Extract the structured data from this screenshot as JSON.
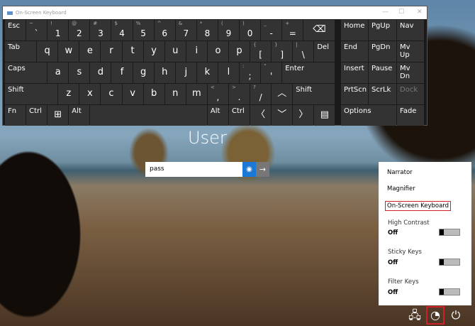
{
  "keyboard": {
    "title": "On-Screen Keyboard",
    "minimize": "—",
    "maximize": "☐",
    "close": "✕",
    "rows": [
      [
        {
          "m": "Esc"
        },
        {
          "s": "~",
          "m": "`"
        },
        {
          "s": "!",
          "m": "1"
        },
        {
          "s": "@",
          "m": "2"
        },
        {
          "s": "#",
          "m": "3"
        },
        {
          "s": "$",
          "m": "4"
        },
        {
          "s": "%",
          "m": "5"
        },
        {
          "s": "^",
          "m": "6"
        },
        {
          "s": "&",
          "m": "7"
        },
        {
          "s": "*",
          "m": "8"
        },
        {
          "s": "(",
          "m": "9"
        },
        {
          "s": ")",
          "m": "0"
        },
        {
          "s": "_",
          "m": "-"
        },
        {
          "s": "+",
          "m": "="
        },
        {
          "m": "⌫"
        }
      ],
      [
        {
          "m": "Tab"
        },
        {
          "m": "q"
        },
        {
          "m": "w"
        },
        {
          "m": "e"
        },
        {
          "m": "r"
        },
        {
          "m": "t"
        },
        {
          "m": "y"
        },
        {
          "m": "u"
        },
        {
          "m": "i"
        },
        {
          "m": "o"
        },
        {
          "m": "p"
        },
        {
          "s": "{",
          "m": "["
        },
        {
          "s": "}",
          "m": "]"
        },
        {
          "s": "|",
          "m": "\\"
        },
        {
          "m": "Del"
        }
      ],
      [
        {
          "m": "Caps"
        },
        {
          "m": "a"
        },
        {
          "m": "s"
        },
        {
          "m": "d"
        },
        {
          "m": "f"
        },
        {
          "m": "g"
        },
        {
          "m": "h"
        },
        {
          "m": "j"
        },
        {
          "m": "k"
        },
        {
          "m": "l"
        },
        {
          "s": ":",
          "m": ";"
        },
        {
          "s": "\"",
          "m": "'"
        },
        {
          "m": "Enter"
        }
      ],
      [
        {
          "m": "Shift"
        },
        {
          "m": "z"
        },
        {
          "m": "x"
        },
        {
          "m": "c"
        },
        {
          "m": "v"
        },
        {
          "m": "b"
        },
        {
          "m": "n"
        },
        {
          "m": "m"
        },
        {
          "s": "<",
          "m": ","
        },
        {
          "s": ">",
          "m": "."
        },
        {
          "s": "?",
          "m": "/"
        },
        {
          "m": "︿"
        },
        {
          "m": "Shift"
        }
      ],
      [
        {
          "m": "Fn"
        },
        {
          "m": "Ctrl"
        },
        {
          "m": "⊞"
        },
        {
          "m": "Alt"
        },
        {
          "m": ""
        },
        {
          "m": "Alt"
        },
        {
          "m": "Ctrl"
        },
        {
          "m": "〈"
        },
        {
          "m": "﹀"
        },
        {
          "m": "〉"
        },
        {
          "m": "▤"
        }
      ]
    ],
    "nav": [
      "Home",
      "PgUp",
      "Nav",
      "End",
      "PgDn",
      "Mv Up",
      "Insert",
      "Pause",
      "Mv Dn",
      "PrtScn",
      "ScrLk",
      "Dock",
      "Options",
      "Fade"
    ]
  },
  "login": {
    "user": "User",
    "password": "pass",
    "reveal_icon": "eye-icon",
    "submit_icon": "arrow-right-icon"
  },
  "ease_menu": {
    "narrator": "Narrator",
    "magnifier": "Magnifier",
    "osk": "On-Screen Keyboard",
    "high_contrast": "High Contrast",
    "sticky_keys": "Sticky Keys",
    "filter_keys": "Filter Keys",
    "off": "Off"
  },
  "accent": "#d0202a"
}
